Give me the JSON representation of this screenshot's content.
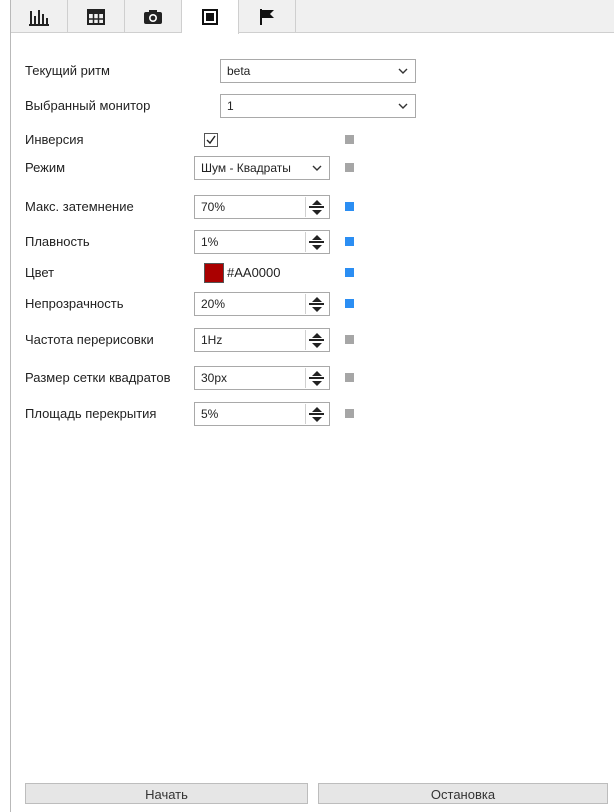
{
  "tabs": [
    {
      "icon": "bar-chart-icon",
      "active": false
    },
    {
      "icon": "grid-table-icon",
      "active": false
    },
    {
      "icon": "camera-icon",
      "active": false
    },
    {
      "icon": "square-stop-icon",
      "active": true
    },
    {
      "icon": "flag-icon",
      "active": false
    }
  ],
  "colors": {
    "indicator_active": "#2b8ef3",
    "indicator_inactive": "#a6a6a6",
    "swatch": "#AA0000"
  },
  "fields": {
    "rhythm": {
      "label": "Текущий ритм",
      "value": "beta"
    },
    "monitor": {
      "label": "Выбранный монитор",
      "value": "1"
    },
    "inversion": {
      "label": "Инверсия",
      "checked": true,
      "indicator": "inactive"
    },
    "mode": {
      "label": "Режим",
      "value": "Шум - Квадраты",
      "indicator": "inactive"
    },
    "max_dim": {
      "label": "Макс. затемнение",
      "value": "70%",
      "indicator": "active"
    },
    "smoothness": {
      "label": "Плавность",
      "value": "1%",
      "indicator": "active"
    },
    "color": {
      "label": "Цвет",
      "value": "#AA0000",
      "indicator": "active"
    },
    "opacity": {
      "label": "Непрозрачность",
      "value": "20%",
      "indicator": "active"
    },
    "redraw": {
      "label": "Частота перерисовки",
      "value": "1Hz",
      "indicator": "inactive"
    },
    "grid_size": {
      "label": "Размер сетки квадратов",
      "value": "30px",
      "indicator": "inactive"
    },
    "overlap": {
      "label": "Площадь перекрытия",
      "value": "5%",
      "indicator": "inactive"
    }
  },
  "buttons": {
    "start": "Начать",
    "stop": "Остановка"
  }
}
